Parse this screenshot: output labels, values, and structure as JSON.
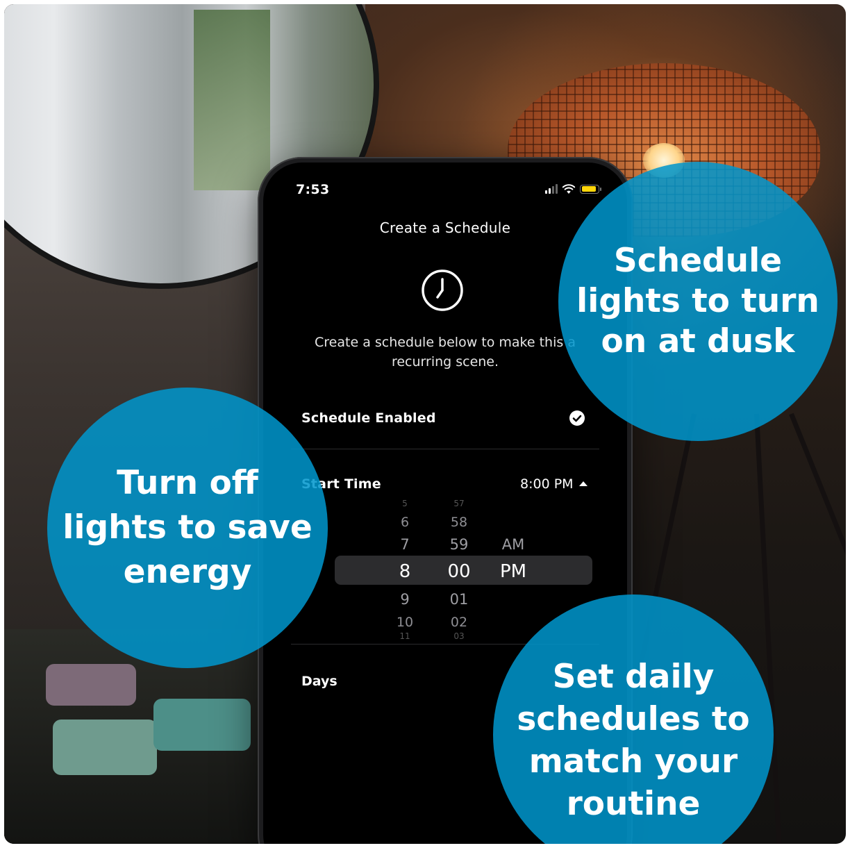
{
  "phone": {
    "status_time": "7:53",
    "screen_title": "Create a Schedule",
    "description": "Create a schedule below to make this a recurring scene.",
    "schedule_enabled_label": "Schedule Enabled",
    "schedule_enabled": true,
    "start_time_label": "Start Time",
    "start_time_value": "8:00 PM",
    "days_label": "Days",
    "picker": {
      "hours": [
        "5",
        "6",
        "7",
        "8",
        "9",
        "10",
        "11"
      ],
      "minutes": [
        "57",
        "58",
        "59",
        "00",
        "01",
        "02",
        "03"
      ],
      "periods": [
        "AM",
        "PM"
      ],
      "selected_hour": "8",
      "selected_minute": "00",
      "selected_period": "PM"
    }
  },
  "callouts": {
    "dusk": [
      "Schedule",
      "lights to turn",
      "on at dusk"
    ],
    "energy": [
      "Turn off",
      "lights to save",
      "energy"
    ],
    "routine": [
      "Set daily",
      "schedules to",
      "match your",
      "routine"
    ]
  },
  "colors": {
    "callout_blue": "#0096CD",
    "battery_yellow": "#FFD60A",
    "screen_bg": "#000000"
  }
}
